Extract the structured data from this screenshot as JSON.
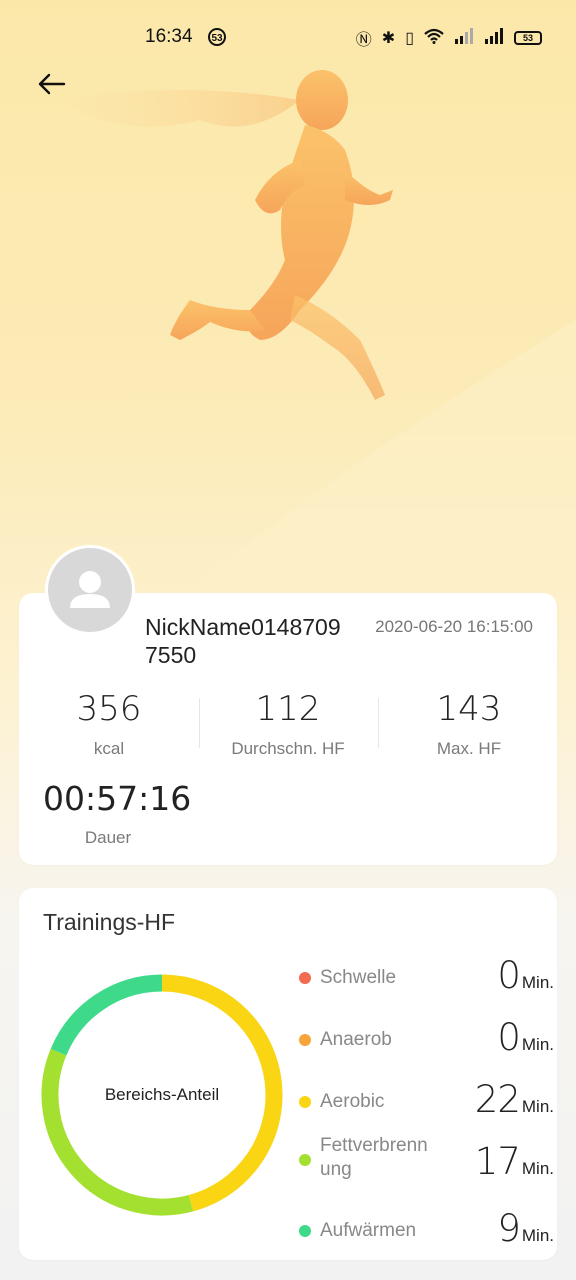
{
  "status_bar": {
    "time": "16:34",
    "notification_count": "53",
    "battery": "53"
  },
  "summary": {
    "nickname": "NickName01487097550",
    "date": "2020-06-20 16:15:00",
    "stats": [
      {
        "value": "356",
        "label": "kcal"
      },
      {
        "value": "112",
        "label": "Durchschn. HF"
      },
      {
        "value": "143",
        "label": "Max. HF"
      }
    ],
    "duration": {
      "value": "00:57:16",
      "label": "Dauer"
    }
  },
  "training_hr": {
    "title": "Trainings-HF",
    "center_label": "Bereichs-Anteil",
    "unit": "Min.",
    "zones": [
      {
        "label": "Schwelle",
        "value": "0",
        "color": "#f26a4f"
      },
      {
        "label": "Anaerob",
        "value": "0",
        "color": "#f5a53a"
      },
      {
        "label": "Aerobic",
        "value": "22",
        "color": "#f9d514"
      },
      {
        "label": "Fettverbrennung",
        "value": "17",
        "color": "#a4e02f"
      },
      {
        "label": "Aufwärmen",
        "value": "9",
        "color": "#3fd98a"
      }
    ]
  }
}
